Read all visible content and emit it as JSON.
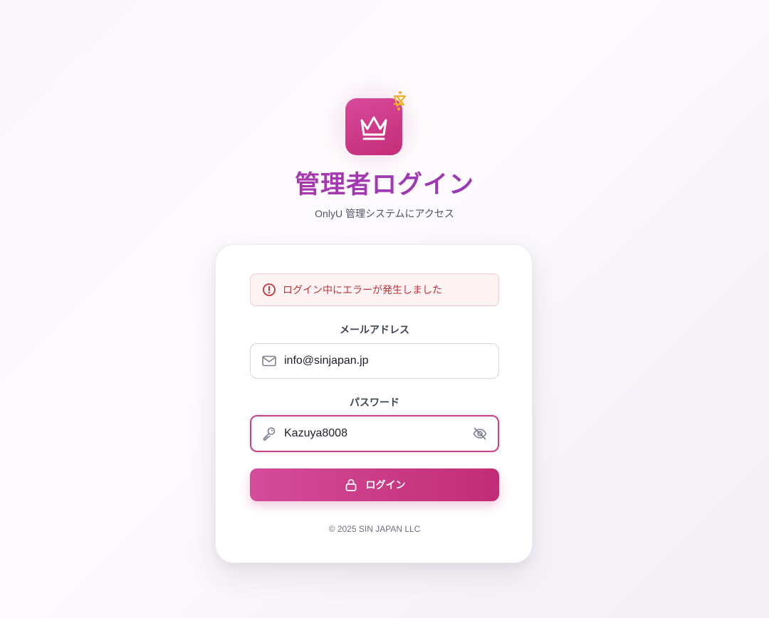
{
  "header": {
    "title": "管理者ログイン",
    "subtitle": "OnlyU 管理システムにアクセス"
  },
  "logo": {
    "icon": "crown-icon",
    "badge_icon": "sparkle-icon"
  },
  "alert": {
    "icon": "alert-circle-icon",
    "message": "ログイン中にエラーが発生しました"
  },
  "form": {
    "email": {
      "label": "メールアドレス",
      "icon": "mail-icon",
      "value": "info@sinjapan.jp"
    },
    "password": {
      "label": "パスワード",
      "icon": "key-icon",
      "value": "Kazuya8008",
      "visibility_icon": "eye-off-icon"
    },
    "submit": {
      "icon": "lock-icon",
      "label": "ログイン"
    }
  },
  "footer": {
    "copyright": "© 2025 SIN JAPAN LLC"
  },
  "colors": {
    "accent": "#c8428a",
    "title_gradient_start": "#c2349b",
    "title_gradient_end": "#8f3fc0",
    "error": "#c0343a",
    "sparkle": "#f2b12b"
  }
}
